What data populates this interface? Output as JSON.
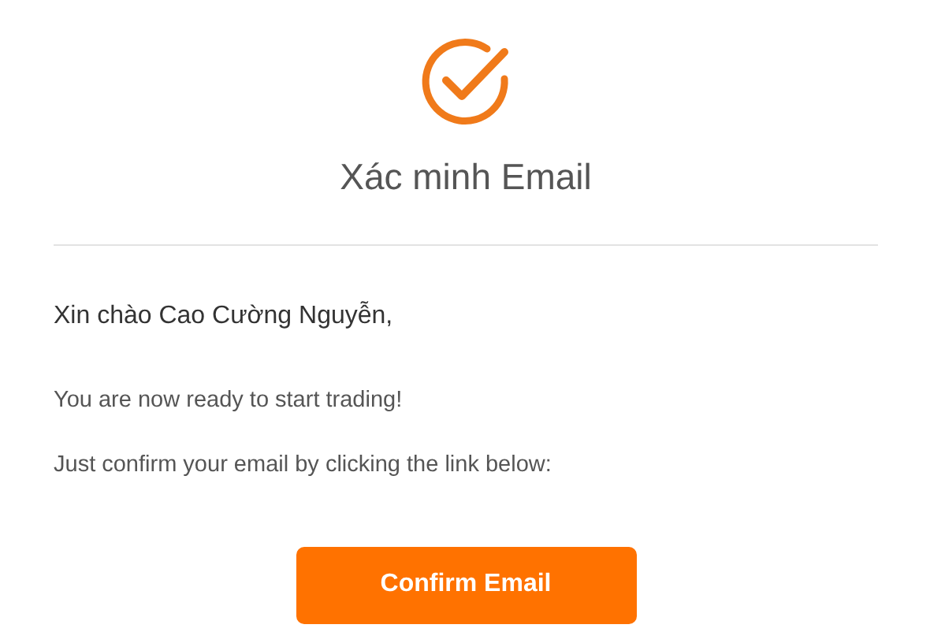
{
  "title": "Xác minh Email",
  "greeting": "Xin chào Cao Cường Nguyễn,",
  "paragraphs": [
    "You are now ready to start trading!",
    "Just confirm your email by clicking the link below:"
  ],
  "button": {
    "label": "Confirm Email"
  }
}
